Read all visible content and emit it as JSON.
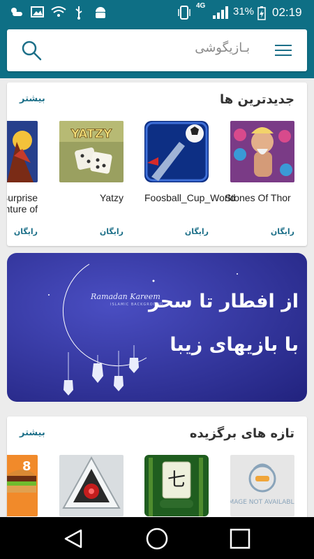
{
  "status_bar": {
    "network": "4G",
    "battery": "31%",
    "time": "02:19",
    "icons": [
      "weather-icon",
      "gallery-icon",
      "wifi-icon",
      "usb-icon",
      "android-icon",
      "phone-vibrate-icon",
      "signal-icon",
      "battery-charging-icon"
    ]
  },
  "header": {
    "search_placeholder": "بـازیگوشی",
    "menu_icon": "hamburger-menu-icon",
    "search_icon": "search-icon"
  },
  "sections": [
    {
      "title": "جدیدترین ها",
      "more": "بیشتر",
      "apps": [
        {
          "name": "Stones Of Thor",
          "price": "رایگان"
        },
        {
          "name": "Foosball_Cup_World",
          "price": "رایگان"
        },
        {
          "name": "Yatzy",
          "price": "رایگان"
        },
        {
          "name": "The Surprise Adventure of",
          "price": "رایگان"
        }
      ]
    },
    {
      "title": "تازه های برگزیده",
      "more": "بیشتر",
      "apps": [
        {
          "name": "",
          "thumb_text": "IMAGE NOT AVAILABLE"
        },
        {
          "name": ""
        },
        {
          "name": ""
        },
        {
          "name": ""
        }
      ]
    }
  ],
  "banner": {
    "line1": "از افطار تا سحر",
    "line2": "با بازیهای زیبا",
    "ramadan": "Ramadan Kareem",
    "sub": "ISLAMIC BACKGROUND"
  },
  "colors": {
    "primary": "#0e6f85",
    "accent": "#1c6f88",
    "banner": "#2e2f96"
  },
  "nav": {
    "icons": [
      "back-icon",
      "home-icon",
      "recents-icon"
    ]
  }
}
